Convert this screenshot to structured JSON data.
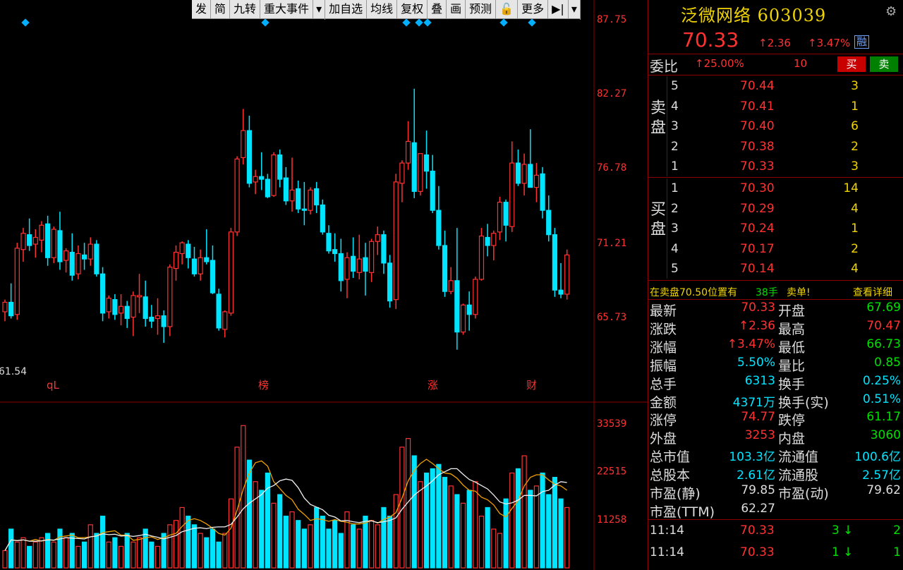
{
  "toolbar": {
    "items": [
      "发",
      "简",
      "九转",
      "重大事件",
      "▾",
      "加自选",
      "均线",
      "复权",
      "叠",
      "画",
      "预测",
      "🔓",
      "更多",
      "▶|",
      "▾"
    ]
  },
  "chart": {
    "price_axis": [
      "87.75",
      "82.27",
      "76.78",
      "71.21",
      "65.73"
    ],
    "low_mark": "61.54",
    "volume_axis": [
      "33539",
      "22515",
      "11258"
    ],
    "event_labels": [
      "qL",
      "榜",
      "涨",
      "财"
    ],
    "colors": {
      "up": "#ff3232",
      "down": "#00e5ff",
      "ma1": "#f0f0f0",
      "ma2": "#f0a000",
      "grid": "#8b0000"
    }
  },
  "chart_data": {
    "type": "candlestick",
    "title": "",
    "ohlc": [
      [
        66.1,
        67.0,
        65.4,
        66.8
      ],
      [
        66.8,
        68.2,
        65.6,
        65.8
      ],
      [
        65.9,
        71.2,
        65.5,
        70.8
      ],
      [
        70.7,
        72.3,
        69.8,
        71.9
      ],
      [
        71.8,
        73.0,
        70.6,
        71.0
      ],
      [
        71.1,
        72.2,
        70.1,
        71.6
      ],
      [
        71.4,
        72.8,
        70.5,
        72.5
      ],
      [
        72.6,
        73.2,
        69.5,
        70.1
      ],
      [
        70.1,
        72.4,
        69.7,
        72.2
      ],
      [
        72.1,
        73.5,
        69.2,
        69.8
      ],
      [
        69.9,
        70.8,
        69.0,
        70.6
      ],
      [
        70.5,
        71.9,
        68.4,
        68.8
      ],
      [
        68.9,
        71.0,
        68.5,
        70.4
      ],
      [
        70.3,
        71.2,
        69.2,
        70.0
      ],
      [
        70.0,
        71.6,
        69.5,
        71.1
      ],
      [
        71.1,
        71.4,
        68.7,
        68.9
      ],
      [
        68.9,
        69.4,
        65.4,
        66.0
      ],
      [
        66.1,
        67.3,
        65.6,
        67.1
      ],
      [
        67.0,
        67.4,
        65.5,
        65.9
      ],
      [
        66.0,
        67.4,
        65.1,
        66.5
      ],
      [
        66.5,
        66.9,
        64.9,
        65.6
      ],
      [
        65.7,
        67.6,
        64.3,
        67.3
      ],
      [
        67.2,
        68.9,
        66.0,
        67.3
      ],
      [
        67.2,
        68.4,
        65.0,
        65.6
      ],
      [
        65.7,
        66.6,
        64.9,
        65.4
      ],
      [
        65.6,
        67.1,
        64.4,
        65.8
      ],
      [
        65.8,
        66.2,
        63.8,
        65.0
      ],
      [
        65.0,
        69.6,
        64.3,
        69.4
      ],
      [
        69.3,
        71.0,
        68.4,
        70.5
      ],
      [
        70.4,
        71.3,
        69.6,
        71.2
      ],
      [
        71.1,
        71.4,
        69.3,
        70.1
      ],
      [
        70.0,
        70.9,
        68.7,
        68.9
      ],
      [
        68.9,
        70.7,
        68.4,
        70.1
      ],
      [
        70.1,
        72.2,
        69.6,
        69.8
      ],
      [
        69.9,
        71.0,
        67.4,
        67.5
      ],
      [
        67.4,
        67.8,
        64.7,
        64.9
      ],
      [
        64.8,
        66.2,
        64.2,
        66.1
      ],
      [
        66.0,
        72.3,
        65.8,
        72.0
      ],
      [
        72.0,
        77.6,
        71.7,
        77.4
      ],
      [
        77.5,
        81.1,
        77.0,
        79.5
      ],
      [
        79.5,
        80.6,
        75.3,
        75.6
      ],
      [
        75.7,
        76.6,
        74.8,
        76.1
      ],
      [
        76.1,
        77.9,
        75.1,
        75.9
      ],
      [
        75.9,
        76.3,
        74.5,
        74.6
      ],
      [
        74.7,
        77.9,
        74.6,
        77.7
      ],
      [
        77.7,
        78.1,
        75.3,
        75.9
      ],
      [
        76.0,
        76.8,
        74.0,
        74.3
      ],
      [
        74.3,
        77.5,
        73.5,
        75.1
      ],
      [
        75.2,
        75.8,
        73.4,
        73.7
      ],
      [
        73.7,
        75.7,
        72.5,
        73.6
      ],
      [
        73.6,
        75.3,
        73.3,
        75.1
      ],
      [
        75.2,
        75.7,
        73.4,
        74.0
      ],
      [
        74.0,
        74.4,
        71.8,
        72.0
      ],
      [
        71.9,
        72.5,
        70.4,
        70.6
      ],
      [
        70.7,
        71.9,
        69.8,
        70.4
      ],
      [
        70.4,
        71.5,
        67.6,
        68.4
      ],
      [
        68.5,
        70.5,
        67.1,
        70.1
      ],
      [
        70.2,
        71.6,
        68.6,
        69.1
      ],
      [
        69.0,
        71.8,
        68.5,
        70.0
      ],
      [
        70.1,
        71.2,
        67.3,
        69.1
      ],
      [
        69.0,
        71.5,
        68.3,
        71.3
      ],
      [
        71.3,
        72.4,
        70.3,
        71.8
      ],
      [
        71.8,
        72.1,
        68.9,
        69.7
      ],
      [
        69.7,
        70.3,
        66.4,
        66.9
      ],
      [
        67.0,
        76.3,
        66.3,
        75.7
      ],
      [
        75.6,
        77.3,
        74.2,
        77.1
      ],
      [
        77.1,
        80.2,
        76.6,
        78.7
      ],
      [
        78.6,
        82.6,
        74.5,
        75.0
      ],
      [
        75.0,
        77.8,
        74.7,
        77.8
      ],
      [
        77.7,
        79.5,
        75.2,
        76.5
      ],
      [
        76.5,
        77.7,
        73.4,
        73.6
      ],
      [
        73.6,
        75.4,
        70.7,
        71.0
      ],
      [
        71.0,
        72.1,
        67.2,
        67.6
      ],
      [
        67.6,
        69.4,
        67.4,
        68.4
      ],
      [
        68.4,
        72.3,
        63.3,
        64.6
      ],
      [
        64.6,
        66.7,
        64.4,
        66.6
      ],
      [
        66.6,
        67.6,
        64.7,
        65.9
      ],
      [
        65.9,
        68.7,
        65.6,
        68.5
      ],
      [
        68.5,
        72.3,
        68.4,
        71.7
      ],
      [
        71.6,
        72.6,
        70.2,
        71.0
      ],
      [
        71.0,
        72.1,
        69.9,
        71.9
      ],
      [
        72.0,
        74.6,
        71.4,
        74.2
      ],
      [
        74.2,
        74.4,
        71.3,
        72.5
      ],
      [
        72.4,
        78.7,
        72.0,
        77.1
      ],
      [
        77.1,
        78.1,
        75.4,
        75.6
      ],
      [
        75.6,
        77.8,
        74.7,
        77.0
      ],
      [
        77.0,
        79.6,
        75.4,
        75.3
      ],
      [
        75.3,
        77.1,
        74.2,
        76.2
      ],
      [
        76.3,
        76.8,
        73.0,
        73.6
      ],
      [
        73.6,
        74.7,
        71.3,
        71.8
      ],
      [
        71.8,
        72.3,
        67.2,
        67.7
      ],
      [
        67.7,
        69.7,
        67.1,
        67.4
      ],
      [
        67.4,
        70.7,
        67.0,
        70.3
      ]
    ],
    "volume": [
      4,
      9,
      6,
      7,
      5,
      6,
      7,
      8,
      6,
      9,
      7,
      8,
      5,
      6,
      10,
      8,
      12,
      6,
      7,
      5,
      8,
      6,
      7,
      9,
      6,
      5,
      8,
      10,
      11,
      14,
      12,
      10,
      8,
      7,
      9,
      6,
      8,
      16,
      28,
      33,
      25,
      20,
      18,
      22,
      15,
      17,
      12,
      13,
      11,
      9,
      10,
      14,
      12,
      9,
      11,
      8,
      13,
      10,
      9,
      12,
      11,
      10,
      14,
      12,
      17,
      28,
      30,
      26,
      20,
      22,
      23,
      24,
      21,
      19,
      17,
      15,
      18,
      20,
      12,
      14,
      9,
      8,
      16,
      22,
      23,
      26,
      18,
      19,
      22,
      17,
      21,
      16,
      14
    ]
  },
  "quote": {
    "name": "泛微网络",
    "code": "603039",
    "price": "70.33",
    "change": "↑2.36",
    "pct": "↑3.47%",
    "tag": "融",
    "weibi_label": "委比",
    "weibi_value": "↑25.00%",
    "weicha": "10",
    "buy_btn": "买",
    "sell_btn": "卖",
    "sell_side": "卖盘",
    "buy_side": "买盘",
    "asks": [
      {
        "lvl": "5",
        "price": "70.44",
        "vol": "3"
      },
      {
        "lvl": "4",
        "price": "70.41",
        "vol": "1"
      },
      {
        "lvl": "3",
        "price": "70.40",
        "vol": "6"
      },
      {
        "lvl": "2",
        "price": "70.38",
        "vol": "2"
      },
      {
        "lvl": "1",
        "price": "70.33",
        "vol": "3"
      }
    ],
    "bids": [
      {
        "lvl": "1",
        "price": "70.30",
        "vol": "14"
      },
      {
        "lvl": "2",
        "price": "70.29",
        "vol": "4"
      },
      {
        "lvl": "3",
        "price": "70.24",
        "vol": "1"
      },
      {
        "lvl": "4",
        "price": "70.17",
        "vol": "2"
      },
      {
        "lvl": "5",
        "price": "70.14",
        "vol": "4"
      }
    ],
    "notice_a": "在卖盘70.50位置有",
    "notice_b": "38手",
    "notice_c": "卖单!",
    "notice_link": "查看详细",
    "stats": [
      {
        "l1": "最新",
        "v1": "70.33",
        "c1": "red",
        "l2": "开盘",
        "v2": "67.69",
        "c2": "green"
      },
      {
        "l1": "涨跌",
        "v1": "↑2.36",
        "c1": "red",
        "l2": "最高",
        "v2": "70.47",
        "c2": "red"
      },
      {
        "l1": "涨幅",
        "v1": "↑3.47%",
        "c1": "red",
        "l2": "最低",
        "v2": "66.73",
        "c2": "green"
      },
      {
        "l1": "振幅",
        "v1": "5.50%",
        "c1": "cyan",
        "l2": "量比",
        "v2": "0.85",
        "c2": "green"
      },
      {
        "l1": "总手",
        "v1": "6313",
        "c1": "cyan",
        "l2": "换手",
        "v2": "0.25%",
        "c2": "cyan"
      },
      {
        "l1": "金额",
        "v1": "4371万",
        "c1": "cyan",
        "l2": "换手(实)",
        "v2": "0.51%",
        "c2": "cyan"
      },
      {
        "l1": "涨停",
        "v1": "74.77",
        "c1": "red",
        "l2": "跌停",
        "v2": "61.17",
        "c2": "green"
      },
      {
        "l1": "外盘",
        "v1": "3253",
        "c1": "red",
        "l2": "内盘",
        "v2": "3060",
        "c2": "green"
      },
      {
        "l1": "总市值",
        "v1": "103.3亿",
        "c1": "cyan",
        "l2": "流通值",
        "v2": "100.6亿",
        "c2": "cyan"
      },
      {
        "l1": "总股本",
        "v1": "2.61亿",
        "c1": "cyan",
        "l2": "流通股",
        "v2": "2.57亿",
        "c2": "cyan"
      },
      {
        "l1": "市盈(静)",
        "v1": "79.85",
        "c1": "white",
        "l2": "市盈(动)",
        "v2": "79.62",
        "c2": "white"
      },
      {
        "l1": "市盈(TTM)",
        "v1": "62.27",
        "c1": "white",
        "l2": "",
        "v2": "",
        "c2": "white"
      }
    ],
    "ticks": [
      {
        "time": "11:14",
        "price": "70.33",
        "vol": "3",
        "arrow": "↓",
        "num": "2"
      },
      {
        "time": "11:14",
        "price": "70.33",
        "vol": "1",
        "arrow": "↓",
        "num": "1"
      }
    ]
  }
}
